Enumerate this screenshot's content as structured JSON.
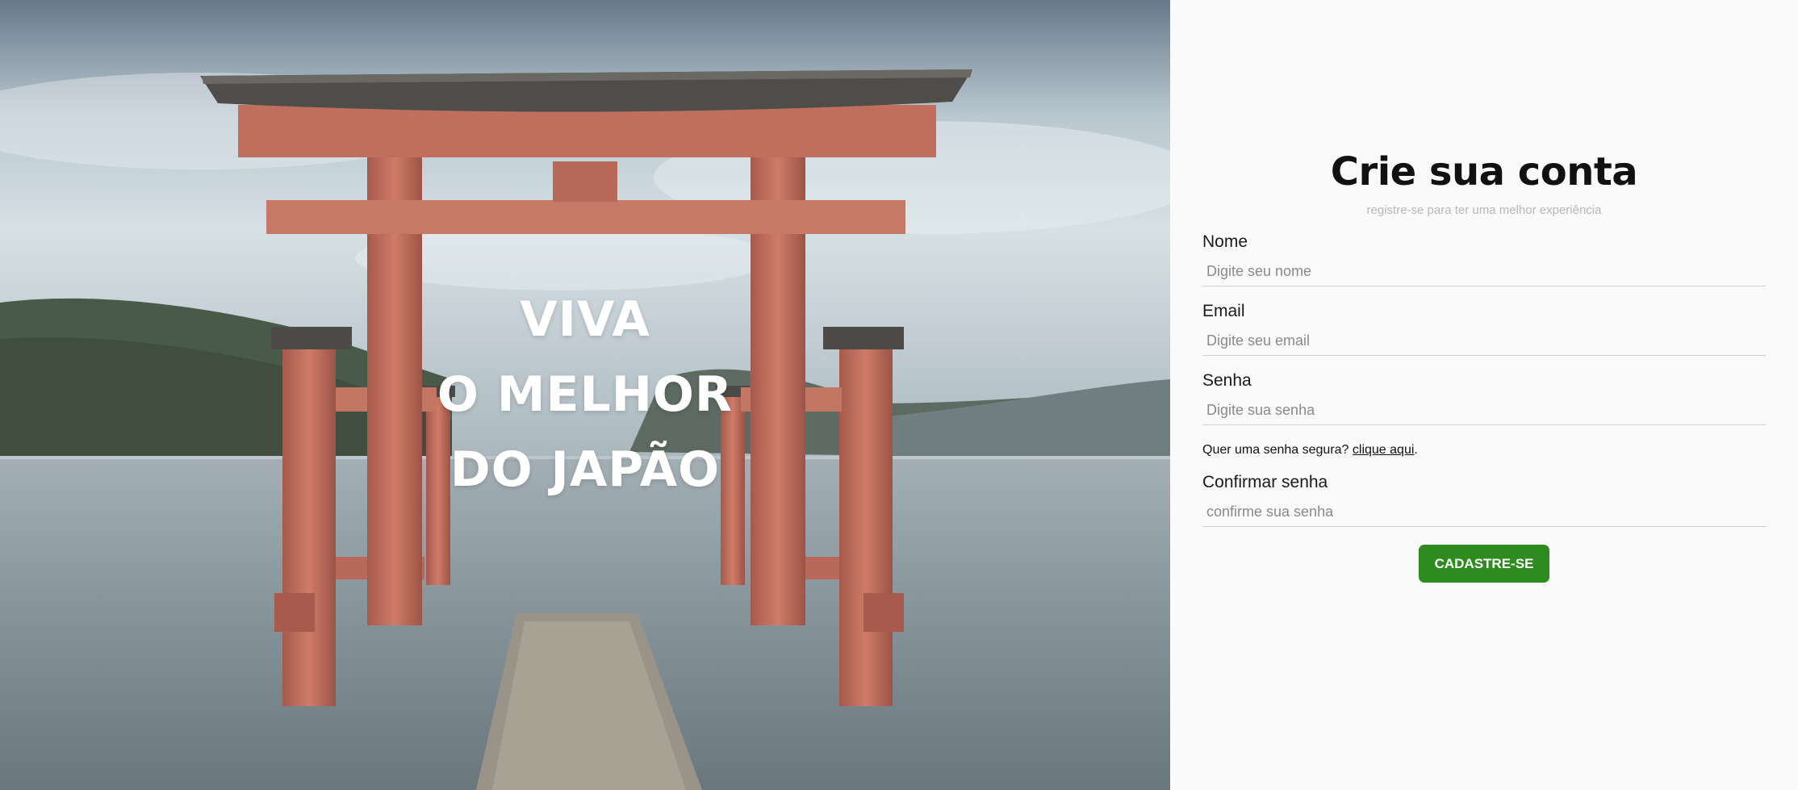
{
  "hero": {
    "headline_lines": [
      "VIVA",
      "O MELHOR",
      "DO JAPÃO"
    ]
  },
  "form": {
    "title": "Crie sua conta",
    "subtitle": "registre-se para ter uma melhor experiência",
    "fields": [
      {
        "label": "Nome",
        "placeholder": "Digite seu nome",
        "value": ""
      },
      {
        "label": "Email",
        "placeholder": "Digite seu email",
        "value": ""
      },
      {
        "label": "Senha",
        "placeholder": "Digite sua senha",
        "value": ""
      },
      {
        "label": "Confirmar senha",
        "placeholder": "confirme sua senha",
        "value": ""
      }
    ],
    "password_hint": {
      "text": "Quer uma senha segura? ",
      "link_text": "clique aqui",
      "suffix": "."
    },
    "submit_label": "CADASTRE-SE"
  },
  "colors": {
    "accent_button": "#2e8b1e",
    "panel_background": "#fafafa",
    "gate_red": "#c8705f"
  }
}
